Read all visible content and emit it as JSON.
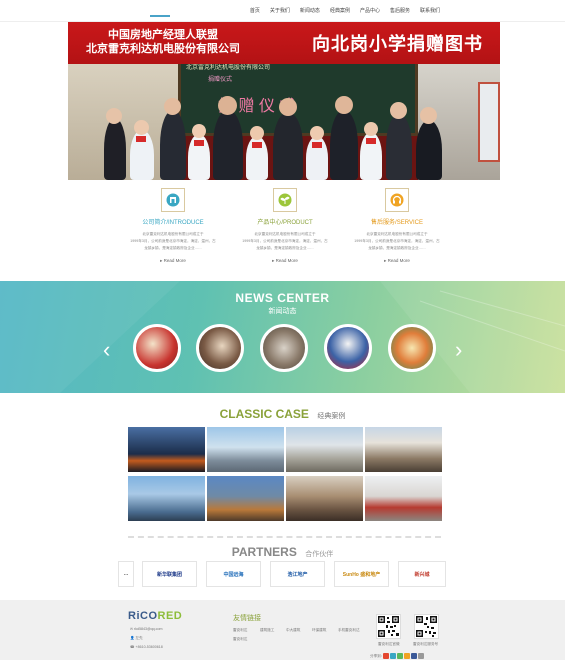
{
  "nav": [
    "首页",
    "关于我们",
    "新闻动态",
    "经典案例",
    "产品中心",
    "售后服务",
    "联系我们"
  ],
  "hero": {
    "banner_line1": "中国房地产经理人联盟",
    "banner_line2": "北京雷克利达机电股份有限公司",
    "banner_big": "向北岗小学捐赠图书",
    "board_line1": "北京雷克利达机电股份有限公司",
    "board_line2": "捐赠仪式",
    "board_big": "捐 赠 仪 式"
  },
  "services": [
    {
      "title": "公司简介/INTRODUCE",
      "desc1": "北京雷克利达机电股份有限公司成立于",
      "desc2": "1999年3月，公司前身是北京市海淀，海淀，温州，古",
      "desc3": "龙镇乡镇，是海淀镇政府及企业……",
      "more": "Read More",
      "icon": "building-icon"
    },
    {
      "title": "产品中心/PRODUCT",
      "desc1": "北京雷克利达机电股份有限公司成立于",
      "desc2": "1999年3月，公司前身是北京市海淀，海淀，温州，古",
      "desc3": "龙镇乡镇，是海淀镇政府及企业……",
      "more": "Read More",
      "icon": "plant-icon"
    },
    {
      "title": "售后服务/SERVICE",
      "desc1": "北京雷克利达机电股份有限公司成立于",
      "desc2": "1999年3月，公司前身是北京市海淀，海淀，温州，古",
      "desc3": "龙镇乡镇，是海淀镇政府及企业……",
      "more": "Read More",
      "icon": "headset-icon"
    }
  ],
  "news": {
    "title": "NEWS CENTER",
    "subtitle": "新闻动态",
    "prev_icon": "chevron-left-icon",
    "next_icon": "chevron-right-icon"
  },
  "classic": {
    "title_en": "CLASSIC CASE",
    "title_cn": "经典案例"
  },
  "partners": {
    "title_en": "PARTNERS",
    "title_cn": "合作伙伴",
    "logos": [
      "…",
      "新华联集团",
      "中国远海",
      "浩江地产",
      "SunHo 盛和地产",
      "新兴城"
    ]
  },
  "footer": {
    "logo_main": "RiCO",
    "logo_green": "RED",
    "email": "rkd5843@qq.com",
    "contact": "左先",
    "phone": "+8610-53600618",
    "links_title": "友情链接",
    "links": [
      "雷克利达",
      "建筑施工",
      "中大建筑",
      "环保建筑",
      "手机雷克利达",
      "雷克利达"
    ],
    "qr_caption_1": "雷克利达官微",
    "qr_caption_2": "雷克利达服务号",
    "share_label": "分享到："
  },
  "colors": {
    "accent": "#3aa7c3",
    "classic_title": "#8aa23a",
    "banner_red": "#c9181a"
  }
}
